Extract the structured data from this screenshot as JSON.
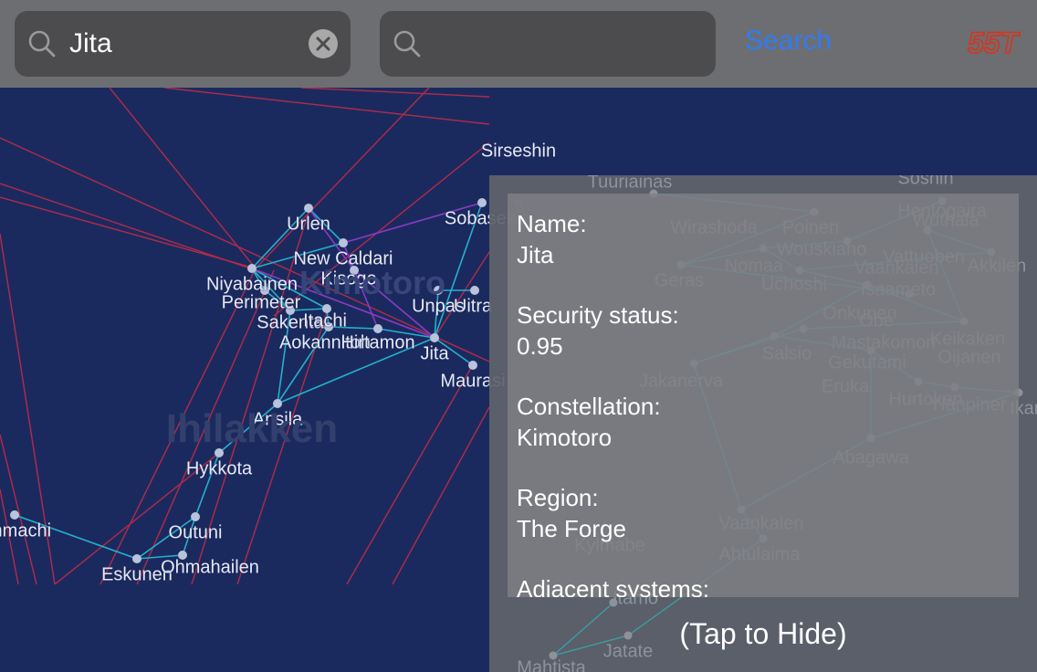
{
  "search": {
    "query": "Jita",
    "second_placeholder": "",
    "button_label": "Search",
    "logo_text": "55T"
  },
  "map": {
    "region_labels": [
      "Ihilakken",
      "Kimotoro"
    ],
    "systems": [
      {
        "name": "Urlen"
      },
      {
        "name": "New Caldari"
      },
      {
        "name": "Kisogo"
      },
      {
        "name": "Niyabainen"
      },
      {
        "name": "Perimeter"
      },
      {
        "name": "Sakenta"
      },
      {
        "name": "Itachi"
      },
      {
        "name": "Aokannitoh"
      },
      {
        "name": "Hirtamon"
      },
      {
        "name": "Jita"
      },
      {
        "name": "Unpas"
      },
      {
        "name": "Uitra"
      },
      {
        "name": "Maurasi"
      },
      {
        "name": "Sobaseki"
      },
      {
        "name": "Sirseshin"
      },
      {
        "name": "Ansila"
      },
      {
        "name": "Hykkota"
      },
      {
        "name": "Outuni"
      },
      {
        "name": "Eskunen"
      },
      {
        "name": "Ohmahailen"
      },
      {
        "name": "Ohmachi"
      }
    ],
    "background_systems": [
      "Tuuriainas",
      "Soshin",
      "Wirashoda",
      "Poinen",
      "Hentogaira",
      "Wuthala",
      "Wouskiaho",
      "Nomaa",
      "Geras",
      "Uchoshi",
      "Vaankalen",
      "Isaameto",
      "Onkunen",
      "Obe",
      "Keikaken",
      "Oijanen",
      "Jakanerva",
      "Salsio",
      "Mastakomon",
      "Gekutami",
      "Eruka",
      "Hurtoken",
      "Ylanpiner",
      "Ikami",
      "Abagawa",
      "Vaankalen",
      "Kylmabe",
      "Ahtulaima",
      "Itamo",
      "Jatate",
      "Mahtista",
      "Akkilen",
      "Vattuoben"
    ],
    "colors": {
      "background": "#1b2a5e",
      "route_teal": "#23b1cc",
      "route_purple": "#8a3bc4",
      "route_red": "#b32a4a"
    }
  },
  "info": {
    "name_label": "Name:",
    "name_value": "Jita",
    "security_label": "Security status:",
    "security_value": "0.95",
    "constellation_label": "Constellation:",
    "constellation_value": "Kimotoro",
    "region_label": "Region:",
    "region_value": "The Forge",
    "adjacent_label": "Adjacent systems:",
    "hide_hint": "(Tap to Hide)"
  }
}
